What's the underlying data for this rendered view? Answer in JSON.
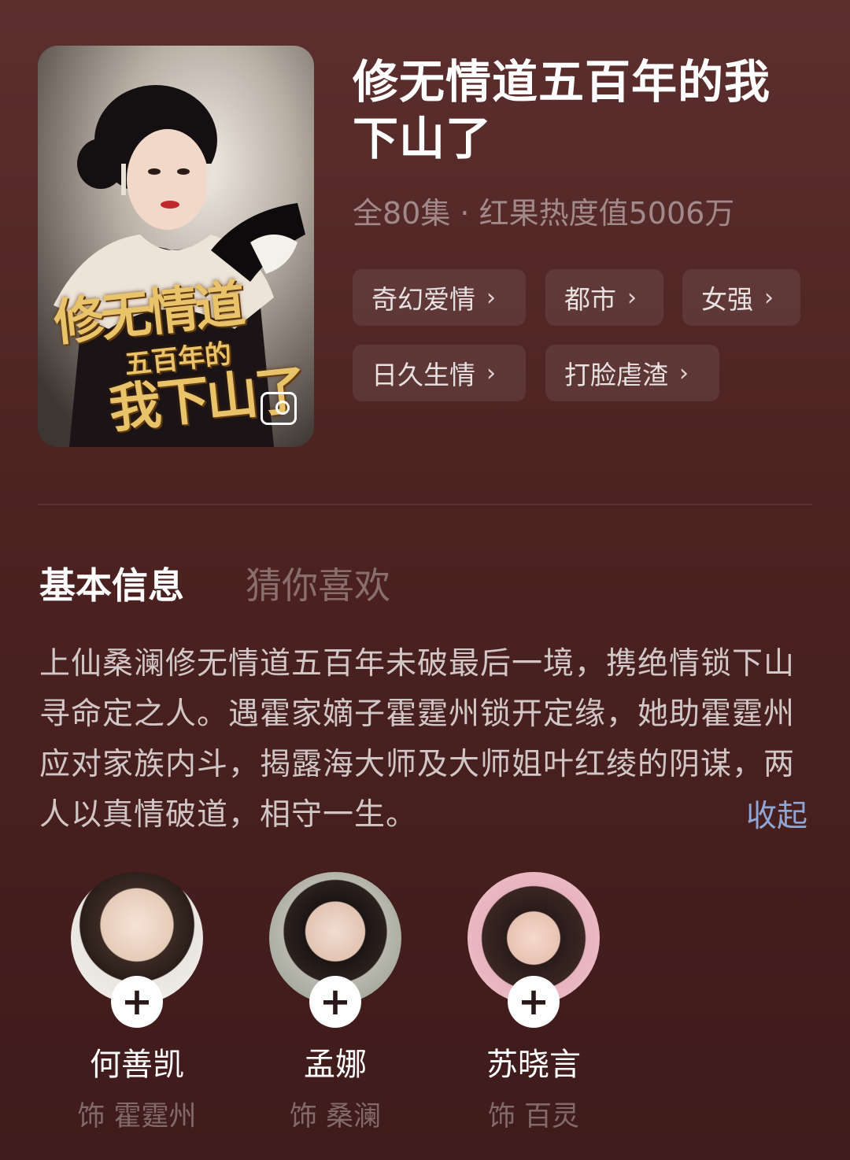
{
  "poster": {
    "icon": "image-icon"
  },
  "drama": {
    "title_line1": "修无情道五百年的我",
    "title_line2": "下山了",
    "meta": "全80集 · 红果热度值5006万"
  },
  "tags": [
    {
      "label": "奇幻爱情"
    },
    {
      "label": "都市"
    },
    {
      "label": "女强"
    },
    {
      "label": "日久生情"
    },
    {
      "label": "打脸虐渣"
    }
  ],
  "tabs": {
    "basic": "基本信息",
    "guess": "猜你喜欢"
  },
  "synopsis": {
    "text": "上仙桑澜修无情道五百年未破最后一境，携绝情锁下山寻命定之人。遇霍家嫡子霍霆州锁开定缘，她助霍霆州应对家族内斗，揭露海大师及大师姐叶红绫的阴谋，两人以真情破道，相守一生。",
    "collapse_label": "收起"
  },
  "cast": [
    {
      "name": "何善凯",
      "role": "饰 霍霆州",
      "follow": "+"
    },
    {
      "name": "孟娜",
      "role": "饰 桑澜",
      "follow": "+"
    },
    {
      "name": "苏晓言",
      "role": "饰 百灵",
      "follow": "+"
    }
  ],
  "colors": {
    "background": "#4c2221",
    "accent_link": "#8fa7d6",
    "title_art": "#e9c36a"
  }
}
